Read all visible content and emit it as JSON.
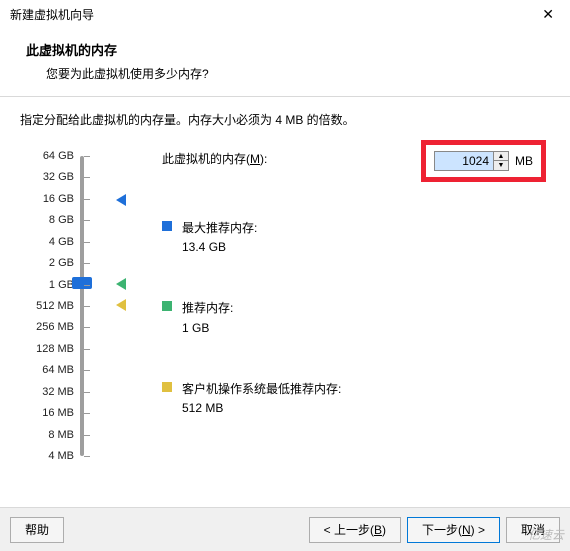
{
  "window": {
    "title": "新建虚拟机向导",
    "close": "✕"
  },
  "header": {
    "title": "此虚拟机的内存",
    "subtitle": "您要为此虚拟机使用多少内存?"
  },
  "instruction": "指定分配给此虚拟机的内存量。内存大小必须为 4 MB 的倍数。",
  "memory": {
    "label_prefix": "此虚拟机的内存(",
    "label_key": "M",
    "label_suffix": "):",
    "value": "1024",
    "unit": "MB"
  },
  "ruler_labels": [
    "64 GB",
    "32 GB",
    "16 GB",
    "8 GB",
    "4 GB",
    "2 GB",
    "1 GB",
    "512 MB",
    "256 MB",
    "128 MB",
    "64 MB",
    "32 MB",
    "16 MB",
    "8 MB",
    "4 MB"
  ],
  "info": {
    "max": {
      "label": "最大推荐内存:",
      "value": "13.4 GB"
    },
    "recommended": {
      "label": "推荐内存:",
      "value": "1 GB"
    },
    "guest": {
      "label": "客户机操作系统最低推荐内存:",
      "value": "512 MB"
    }
  },
  "footer": {
    "help": "帮助",
    "back_prefix": "< 上一步(",
    "back_key": "B",
    "back_suffix": ")",
    "next_prefix": "下一步(",
    "next_key": "N",
    "next_suffix": ") >",
    "cancel": "取消"
  },
  "watermark": "亿速云"
}
